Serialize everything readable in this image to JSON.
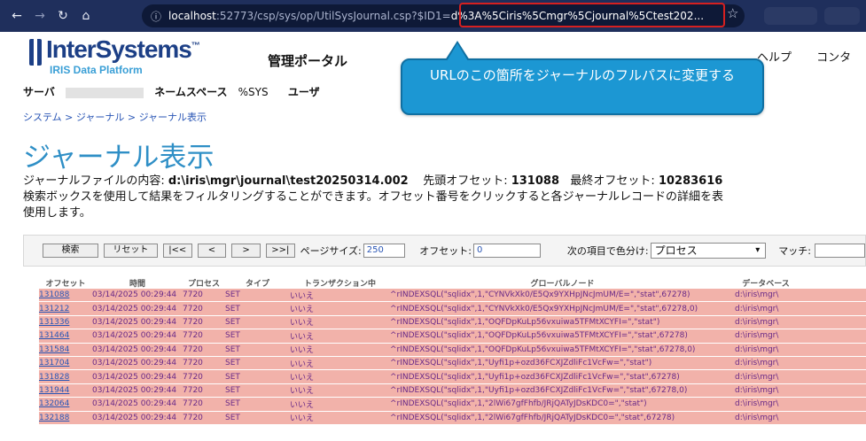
{
  "browser": {
    "url_host": "localhost",
    "url_path": ":52773/csp/sys/op/UtilSysJournal.csp?$ID1=",
    "url_highlight": "d%3A%5Ciris%5Cmgr%5Cjournal%5Ctest202..."
  },
  "portal": {
    "logo": "InterSystems",
    "logo_mark": "™",
    "logo_sub": "IRIS Data Platform",
    "title": "管理ポータル",
    "menu": [
      "... ",
      "...　",
      "ヘルプ",
      "コンタ"
    ],
    "server_label": "サーバ",
    "namespace_label": "ネームスペース",
    "namespace_value": "%SYS",
    "user_label": "ユーザ"
  },
  "callout": "URLのこの箇所をジャーナルのフルパスに変更する",
  "breadcrumb": [
    "システム",
    "ジャーナル",
    "ジャーナル表示"
  ],
  "page": {
    "title": "ジャーナル表示",
    "content_label": "ジャーナルファイルの内容:",
    "content_path": "d:\\iris\\mgr\\journal\\test20250314.002",
    "start_label": "先頭オフセット:",
    "start_value": "131088",
    "end_label": "最終オフセット:",
    "end_value": "10283616",
    "desc1": "検索ボックスを使用して結果をフィルタリングすることができます。オフセット番号をクリックすると各ジャーナルレコードの詳細を表",
    "desc2": "使用します。"
  },
  "toolbar": {
    "search": "検索",
    "reset": "リセット",
    "first": "|<<",
    "prev": "<",
    "next": ">",
    "last": ">>|",
    "pagesize_label": "ページサイズ:",
    "pagesize": "250",
    "offset_label": "オフセット:",
    "offset": "0",
    "color_label": "次の項目で色分け:",
    "color_value": "プロセス",
    "match_label": "マッチ:"
  },
  "table": {
    "headers": [
      "オフセット",
      "時間",
      "プロセス",
      "タイプ",
      "トランザクション中",
      "グローバルノード",
      "データベース"
    ],
    "rows": [
      [
        "131088",
        "03/14/2025 00:29:44",
        "7720",
        "SET",
        "いいえ",
        "^rINDEXSQL(\"sqlidx\",1,\"CYNVkXk0/E5Qx9YXHpJNcJmUM/E=\",\"stat\",67278)",
        "d:\\iris\\mgr\\"
      ],
      [
        "131212",
        "03/14/2025 00:29:44",
        "7720",
        "SET",
        "いいえ",
        "^rINDEXSQL(\"sqlidx\",1,\"CYNVkXk0/E5Qx9YXHpJNcJmUM/E=\",\"stat\",67278,0)",
        "d:\\iris\\mgr\\"
      ],
      [
        "131336",
        "03/14/2025 00:29:44",
        "7720",
        "SET",
        "いいえ",
        "^rINDEXSQL(\"sqlidx\",1,\"OQFDpKuLp56vxuiwa5TFMtXCYFI=\",\"stat\")",
        "d:\\iris\\mgr\\"
      ],
      [
        "131464",
        "03/14/2025 00:29:44",
        "7720",
        "SET",
        "いいえ",
        "^rINDEXSQL(\"sqlidx\",1,\"OQFDpKuLp56vxuiwa5TFMtXCYFI=\",\"stat\",67278)",
        "d:\\iris\\mgr\\"
      ],
      [
        "131584",
        "03/14/2025 00:29:44",
        "7720",
        "SET",
        "いいえ",
        "^rINDEXSQL(\"sqlidx\",1,\"OQFDpKuLp56vxuiwa5TFMtXCYFI=\",\"stat\",67278,0)",
        "d:\\iris\\mgr\\"
      ],
      [
        "131704",
        "03/14/2025 00:29:44",
        "7720",
        "SET",
        "いいえ",
        "^rINDEXSQL(\"sqlidx\",1,\"Uyfi1p+ozd36FCXJZdliFc1VcFw=\",\"stat\")",
        "d:\\iris\\mgr\\"
      ],
      [
        "131828",
        "03/14/2025 00:29:44",
        "7720",
        "SET",
        "いいえ",
        "^rINDEXSQL(\"sqlidx\",1,\"Uyfi1p+ozd36FCXJZdliFc1VcFw=\",\"stat\",67278)",
        "d:\\iris\\mgr\\"
      ],
      [
        "131944",
        "03/14/2025 00:29:44",
        "7720",
        "SET",
        "いいえ",
        "^rINDEXSQL(\"sqlidx\",1,\"Uyfi1p+ozd36FCXJZdliFc1VcFw=\",\"stat\",67278,0)",
        "d:\\iris\\mgr\\"
      ],
      [
        "132064",
        "03/14/2025 00:29:44",
        "7720",
        "SET",
        "いいえ",
        "^rINDEXSQL(\"sqlidx\",1,\"2lWi67gfFhfb/JRjQATyJDsKDC0=\",\"stat\")",
        "d:\\iris\\mgr\\"
      ],
      [
        "132188",
        "03/14/2025 00:29:44",
        "7720",
        "SET",
        "いいえ",
        "^rINDEXSQL(\"sqlidx\",1,\"2lWi67gfFhfb/JRjQATyJDsKDC0=\",\"stat\",67278)",
        "d:\\iris\\mgr\\"
      ]
    ]
  }
}
